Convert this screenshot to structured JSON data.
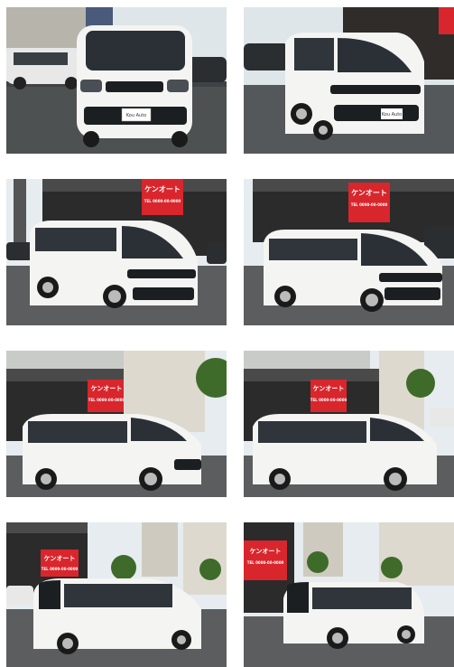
{
  "gallery": {
    "photos": [
      {
        "id": "front-view"
      },
      {
        "id": "front-right-view"
      },
      {
        "id": "front-left-angle-view"
      },
      {
        "id": "front-right-angle-view"
      },
      {
        "id": "left-side-front-view"
      },
      {
        "id": "right-side-view"
      },
      {
        "id": "rear-left-view"
      },
      {
        "id": "rear-right-view"
      }
    ]
  },
  "text": {
    "plate": "Kou Auto",
    "sign": "ケンオート",
    "sign_phone": "TEL 0000-00-0000"
  },
  "colors": {
    "car_body": "#f4f4f2",
    "window": "#2a3036",
    "shop_wall": "#2b2b2b",
    "shop_sign": "#d8262c",
    "sky": "#e6ecef",
    "ground": "#5b5d5e"
  }
}
